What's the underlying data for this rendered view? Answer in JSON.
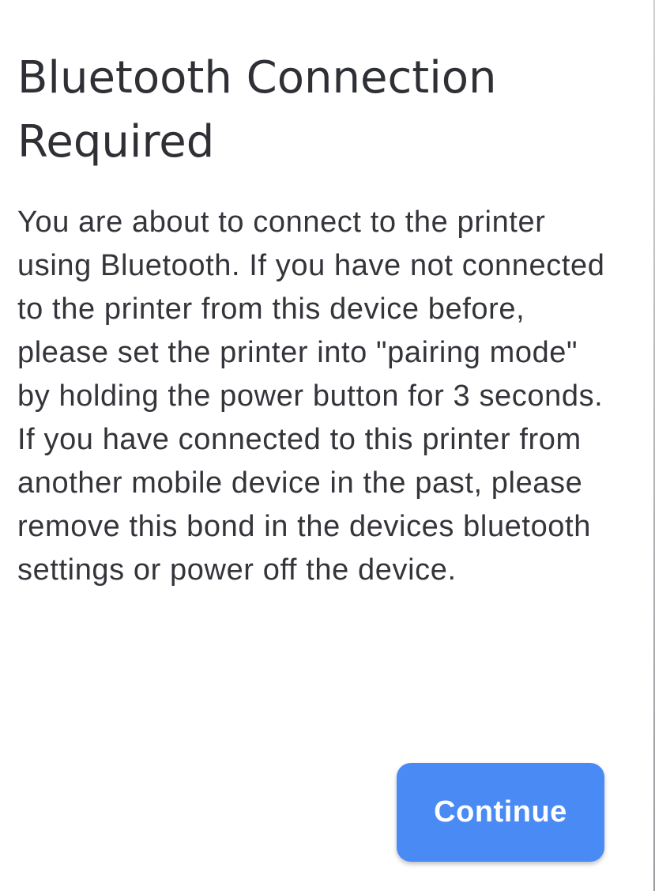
{
  "dialog": {
    "title": "Bluetooth Connection Required",
    "message": "You are about to connect to the printer using Bluetooth. If you have not connected to the printer from this device before, please set the printer into \"pairing mode\" by holding the power button for 3 seconds. If you have connected to this printer from another mobile device in the past, please remove this bond in the devices bluetooth settings or power off the device.",
    "continue_label": "Continue"
  },
  "colors": {
    "button_background": "#4a8af4",
    "button_text": "#ffffff",
    "text_primary": "#2f3036",
    "background": "#ffffff"
  }
}
